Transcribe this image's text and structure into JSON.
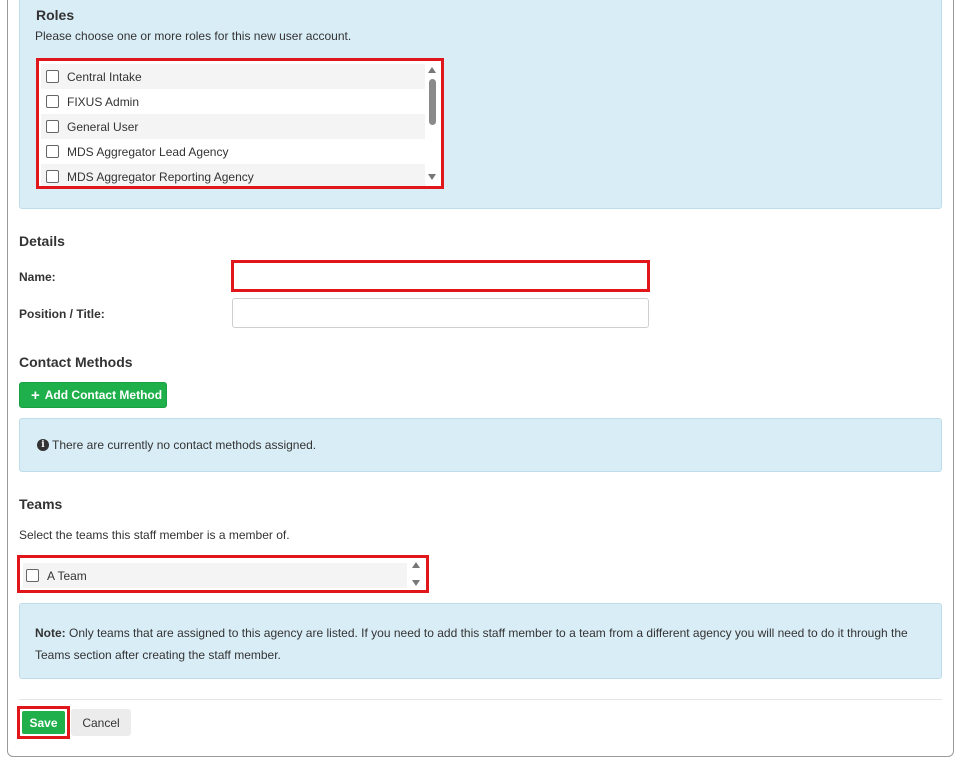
{
  "roles": {
    "title": "Roles",
    "description": "Please choose one or more roles for this new user account.",
    "options": [
      {
        "label": "Central Intake",
        "checked": false
      },
      {
        "label": "FIXUS Admin",
        "checked": false
      },
      {
        "label": "General User",
        "checked": false
      },
      {
        "label": "MDS Aggregator Lead Agency",
        "checked": false
      },
      {
        "label": "MDS Aggregator Reporting Agency",
        "checked": false
      }
    ]
  },
  "details": {
    "title": "Details",
    "name_label": "Name:",
    "name_value": "",
    "position_label": "Position / Title:",
    "position_value": ""
  },
  "contact": {
    "title": "Contact Methods",
    "add_button_label": "Add Contact Method",
    "empty_message": "There are currently no contact methods assigned."
  },
  "teams": {
    "title": "Teams",
    "description": "Select the teams this staff member is a member of.",
    "options": [
      {
        "label": "A Team",
        "checked": false
      }
    ],
    "note_label": "Note:",
    "note_text": "Only teams that are assigned to this agency are listed. If you need to add this staff member to a team from a different agency you will need to do it through the Teams section after creating the staff member."
  },
  "actions": {
    "save_label": "Save",
    "cancel_label": "Cancel"
  },
  "colors": {
    "accent_green": "#1fb04c",
    "info_bg": "#d9edf7",
    "highlight_red": "#e0161b"
  },
  "icons": {
    "add": "plus-icon",
    "info": "info-circle-icon",
    "scroll_up": "arrow-up-icon",
    "scroll_down": "arrow-down-icon"
  }
}
